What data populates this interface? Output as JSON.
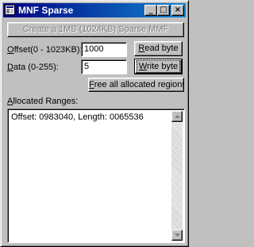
{
  "window": {
    "title": "MNF Sparse",
    "caption_buttons": {
      "minimize": "_",
      "maximize": "□",
      "close": "×"
    }
  },
  "create_button": {
    "label": "Create a 1MB (1024KB) Sparse MMF"
  },
  "offset": {
    "label_hotkey": "O",
    "label_rest": "ffset(0 - 1023KB):",
    "value": "1000"
  },
  "data": {
    "label_hotkey": "D",
    "label_rest": "ata (0-255):",
    "value": "5"
  },
  "read_button": {
    "label_hotkey": "R",
    "label_rest": "ead byte"
  },
  "write_button": {
    "label_hotkey": "W",
    "label_rest": "rite byte"
  },
  "free_button": {
    "label_hotkey": "F",
    "label_rest": "ree all allocated regions"
  },
  "allocated": {
    "label_hotkey": "A",
    "label_rest": "llocated Ranges:",
    "items": [
      "Offset: 0983040, Length: 0065536"
    ]
  },
  "colors": {
    "title_start": "#000080",
    "title_end": "#1084d0",
    "face": "#c0c0c0"
  }
}
